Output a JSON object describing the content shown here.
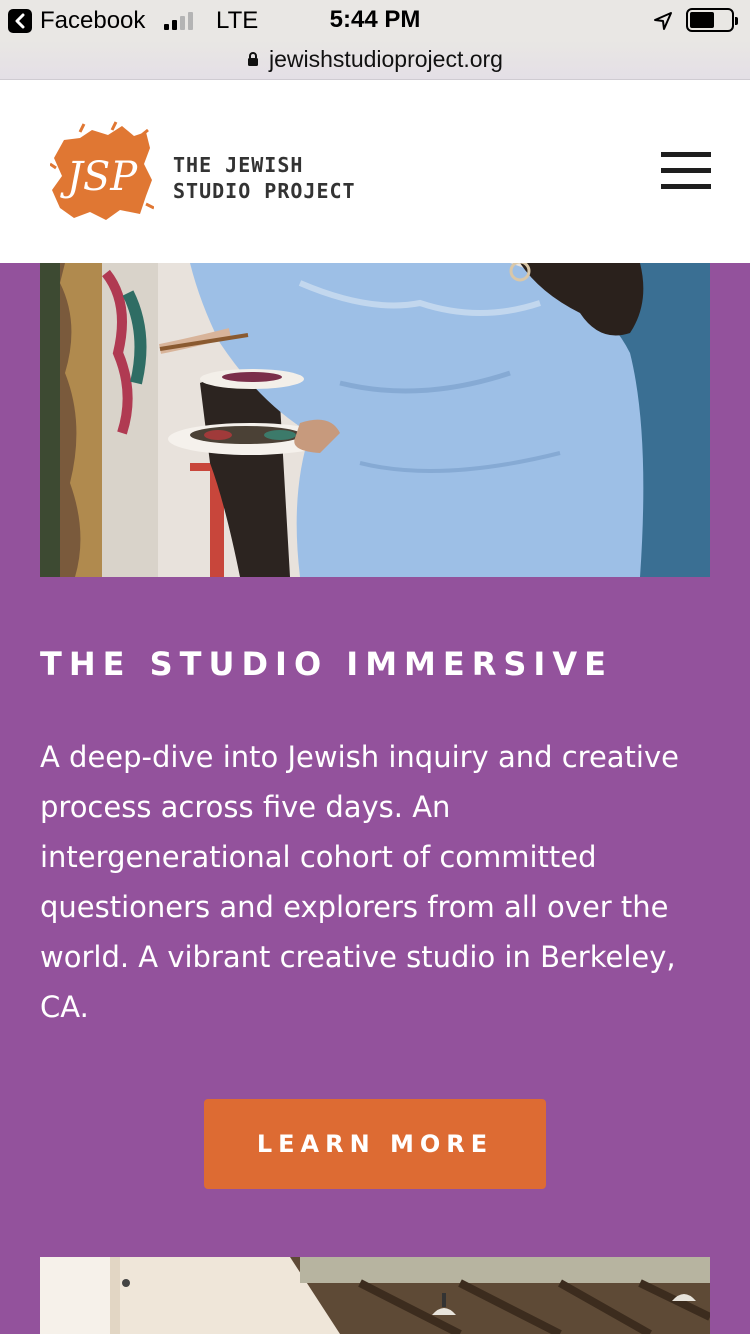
{
  "status_bar": {
    "back_app": "Facebook",
    "carrier": "LTE",
    "time": "5:44 PM",
    "battery_level": 0.6,
    "signal_bars": 2
  },
  "browser": {
    "url": "jewishstudioproject.org"
  },
  "header": {
    "logo_mark_text": "JSP",
    "logo_line1": "THE JEWISH",
    "logo_line2": "STUDIO PROJECT"
  },
  "section": {
    "title": "THE STUDIO IMMERSIVE",
    "body": "A deep-dive into Jewish inquiry and creative process across five days. An intergenerational cohort of committed questioners and explorers from all over the world. A vibrant creative studio in Berkeley, CA.",
    "cta_label": "LEARN MORE"
  },
  "colors": {
    "section_bg": "#93529c",
    "cta_bg": "#dd6b33",
    "logo_orange": "#e07733"
  }
}
